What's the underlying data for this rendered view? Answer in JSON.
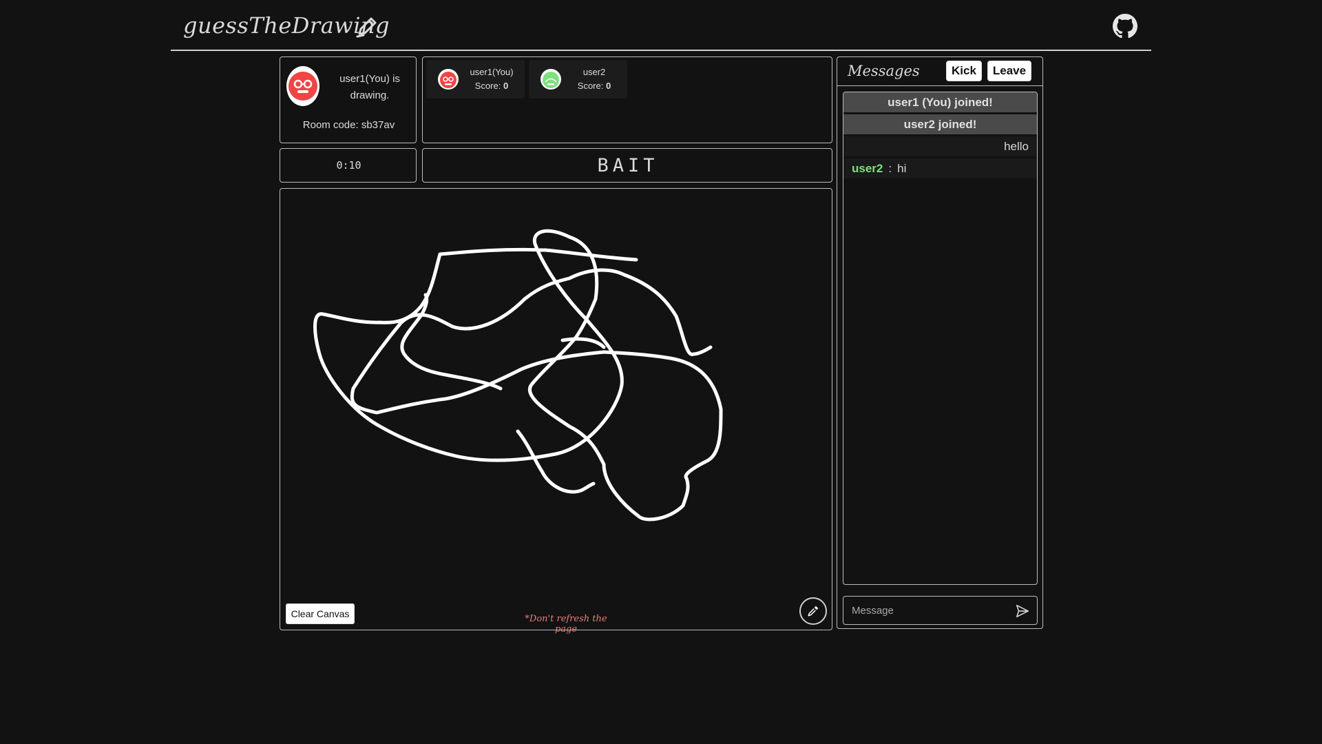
{
  "app": {
    "title": "guessTheDrawing"
  },
  "drawer": {
    "status": "user1(You) is drawing.",
    "room_code": "Room code: sb37av"
  },
  "players": [
    {
      "name": "user1(You)",
      "score_label": "Score:",
      "score": "0",
      "avatar_color": "#f04545"
    },
    {
      "name": "user2",
      "score_label": "Score:",
      "score": "0",
      "avatar_color": "#7fe07f"
    }
  ],
  "game": {
    "timer": "0:10",
    "word": "BAIT"
  },
  "canvas": {
    "clear_label": "Clear Canvas",
    "warning": "*Don't refresh the page",
    "stroke_color": "#ffffff",
    "picker_icon": "eyedropper-icon"
  },
  "messages": {
    "title": "Messages",
    "kick_label": "Kick",
    "leave_label": "Leave",
    "system": [
      "user1 (You) joined!",
      "user2 joined!"
    ],
    "own": [
      "hello"
    ],
    "chat": [
      {
        "user": "user2",
        "sep": ":",
        "text": "hi"
      }
    ],
    "input_placeholder": "Message"
  },
  "colors": {
    "background": "#121212",
    "accent_red": "#f04545",
    "accent_green": "#7fe07f",
    "warning": "#f07a7a"
  }
}
